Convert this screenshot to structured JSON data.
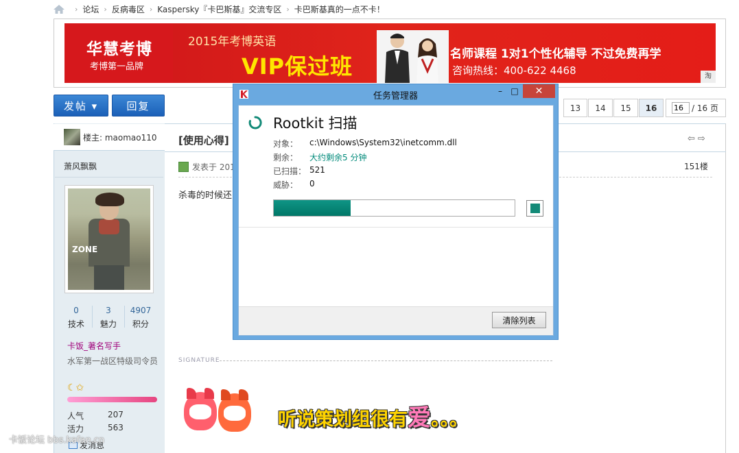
{
  "breadcrumb": {
    "items": [
      "论坛",
      "反病毒区",
      "Kaspersky『卡巴斯基』交流专区",
      "卡巴斯基真的一点不卡！"
    ],
    "separator": "›"
  },
  "banner": {
    "brand": "华慧考博",
    "brand_sub": "考博第一品牌",
    "line1": "2015年考博英语",
    "line2": "VIP保过班",
    "line3": "名师课程  1对1个性化辅导  不过免费再学",
    "line4": "咨询热线：400-622 4468",
    "badge": "淘"
  },
  "actions": {
    "post_label": "发帖 ▾",
    "reply_label": "回复"
  },
  "pagination": {
    "pages": [
      "13",
      "14",
      "15",
      "16"
    ],
    "current": "16",
    "jump_value": "16",
    "total_label": "/ 16 页"
  },
  "user": {
    "op_label": "楼主: maomao110",
    "display_name": "萧风飘飘",
    "avatar_text": "ZONE",
    "stats": [
      {
        "value": "0",
        "label": "技术"
      },
      {
        "value": "3",
        "label": "魅力"
      },
      {
        "value": "4907",
        "label": "积分"
      }
    ],
    "group": "卡饭_著名写手",
    "title": "水军第一战区特级司令员",
    "stars": "☾✩",
    "kv": [
      {
        "key": "人气",
        "value": "207"
      },
      {
        "key": "活力",
        "value": "563"
      }
    ],
    "message_link": "发消息"
  },
  "post": {
    "title": "[使用心得]",
    "meta": "发表于 201",
    "floor": "151楼",
    "body": "杀毒的时候还",
    "nav_arrows": "⇦⇨",
    "signature_label": "SIGNATURE",
    "signature_text_a": "听说策划组很有",
    "signature_text_b": "爱",
    "signature_text_c": "。。。"
  },
  "dialog": {
    "title": "任务管理器",
    "heading": "Rootkit 扫描",
    "rows": [
      {
        "key": "对象：",
        "value": "c:\\Windows\\System32\\inetcomm.dll"
      },
      {
        "key": "剩余：",
        "value": "大约剩余5 分钟"
      },
      {
        "key": "已扫描：",
        "value": "521"
      },
      {
        "key": "威胁：",
        "value": "0"
      }
    ],
    "progress": 0.32,
    "clear_button": "清除列表",
    "controls": {
      "min": "–",
      "max": "□",
      "close": "✕"
    },
    "accent": "#007767"
  },
  "watermark": "卡饭论坛 bbs.kafan.cn"
}
